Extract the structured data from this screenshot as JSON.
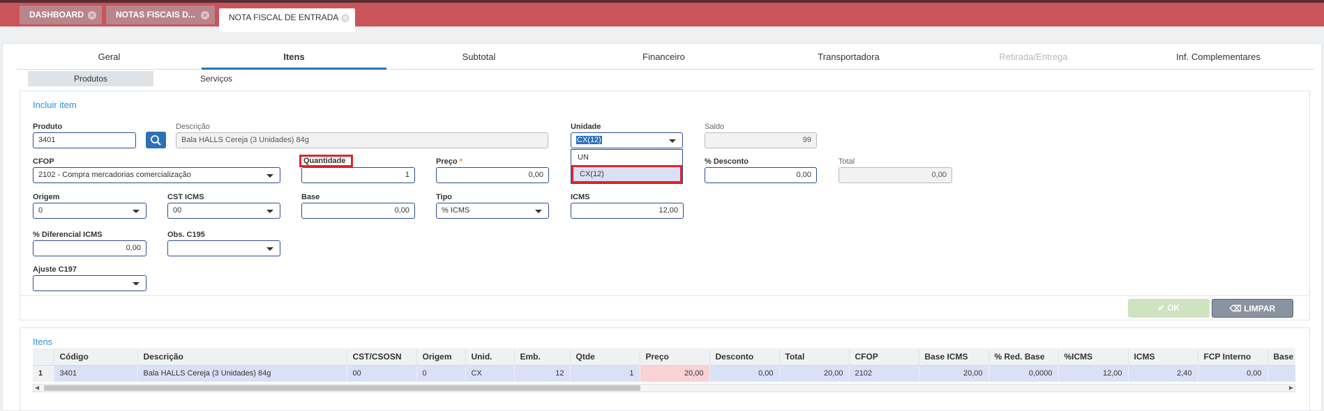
{
  "tabs": [
    {
      "label": "DASHBOARD"
    },
    {
      "label": "NOTAS FISCAIS D..."
    },
    {
      "label": "NOTA FISCAL DE ENTRADA"
    }
  ],
  "nav_tabs": [
    "Geral",
    "Itens",
    "Subtotal",
    "Financeiro",
    "Transportadora",
    "Retirada/Entrega",
    "Inf. Complementares"
  ],
  "sub_tabs": [
    "Produtos",
    "Serviços"
  ],
  "form": {
    "title": "Incluir item",
    "produto": {
      "label": "Produto",
      "value": "3401"
    },
    "descricao": {
      "label": "Descrição",
      "value": "Bala HALLS Cereja (3 Unidades) 84g"
    },
    "unidade": {
      "label": "Unidade",
      "value": "CX(12)",
      "options": [
        "UN",
        "CX(12)"
      ]
    },
    "saldo": {
      "label": "Saldo",
      "value": "99"
    },
    "cfop": {
      "label": "CFOP",
      "value": "2102 - Compra mercadorias comercialização"
    },
    "quantidade": {
      "label": "Quantidade",
      "value": "1"
    },
    "preco": {
      "label": "Preço",
      "required_mark": "*",
      "value": "0,00"
    },
    "desconto": {
      "label": "% Desconto",
      "value": "0,00"
    },
    "total": {
      "label": "Total",
      "value": "0,00"
    },
    "origem": {
      "label": "Origem",
      "value": "0"
    },
    "cst_icms": {
      "label": "CST ICMS",
      "value": "00"
    },
    "base": {
      "label": "Base",
      "value": "0,00"
    },
    "tipo": {
      "label": "Tipo",
      "value": "% ICMS"
    },
    "icms": {
      "label": "ICMS",
      "value": "12,00"
    },
    "dif_icms": {
      "label": "% Diferencial ICMS",
      "value": "0,00"
    },
    "obs_c195": {
      "label": "Obs. C195",
      "value": ""
    },
    "ajuste_c197": {
      "label": "Ajuste C197",
      "value": ""
    },
    "ok_label": "OK",
    "limpar_label": "LIMPAR"
  },
  "items": {
    "title": "Itens",
    "columns": [
      "",
      "Código",
      "Descrição",
      "CST/CSOSN",
      "Origem",
      "Unid.",
      "Emb.",
      "Qtde",
      "Preço",
      "Desconto",
      "Total",
      "CFOP",
      "Base ICMS",
      "% Red. Base",
      "%ICMS",
      "ICMS",
      "FCP Interno",
      "Base"
    ],
    "rows": [
      [
        "1",
        "3401",
        "Bala HALLS Cereja (3 Unidades) 84g",
        "00",
        "0",
        "CX",
        "12",
        "1",
        "20,00",
        "0,00",
        "20,00",
        "2102",
        "20,00",
        "0,0000",
        "12,00",
        "2,40",
        "0,00",
        ""
      ]
    ]
  },
  "colors": {
    "header_bar": "#c9555b",
    "accent_blue": "#2b71b8",
    "highlight_red": "#e0252b",
    "ok_button": "#cfe3c0",
    "limpar_button": "#8a93a0"
  }
}
